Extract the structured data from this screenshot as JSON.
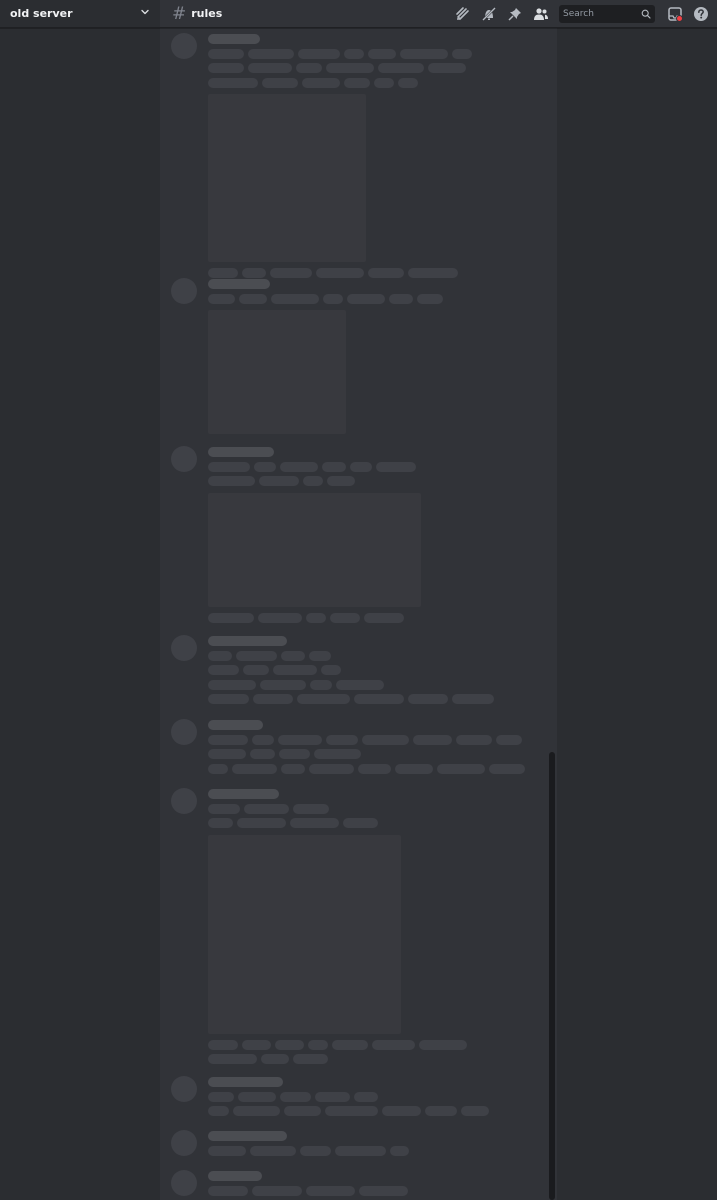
{
  "server": {
    "name": "old server",
    "chevron_icon": "chevron-down-icon"
  },
  "channel": {
    "prefix_icon": "hashtag-icon",
    "name": "rules"
  },
  "toolbar": {
    "icons": [
      "threads-icon",
      "notification-off-icon",
      "pin-icon",
      "members-icon",
      "inbox-icon",
      "help-icon"
    ]
  },
  "search": {
    "placeholder": "Search",
    "value": ""
  },
  "colors": {
    "sidebar_bg": "#2b2d31",
    "main_bg": "#313338",
    "skeleton": "#3f4147",
    "notification_dot": "#f23f43"
  },
  "messages_loading": true
}
